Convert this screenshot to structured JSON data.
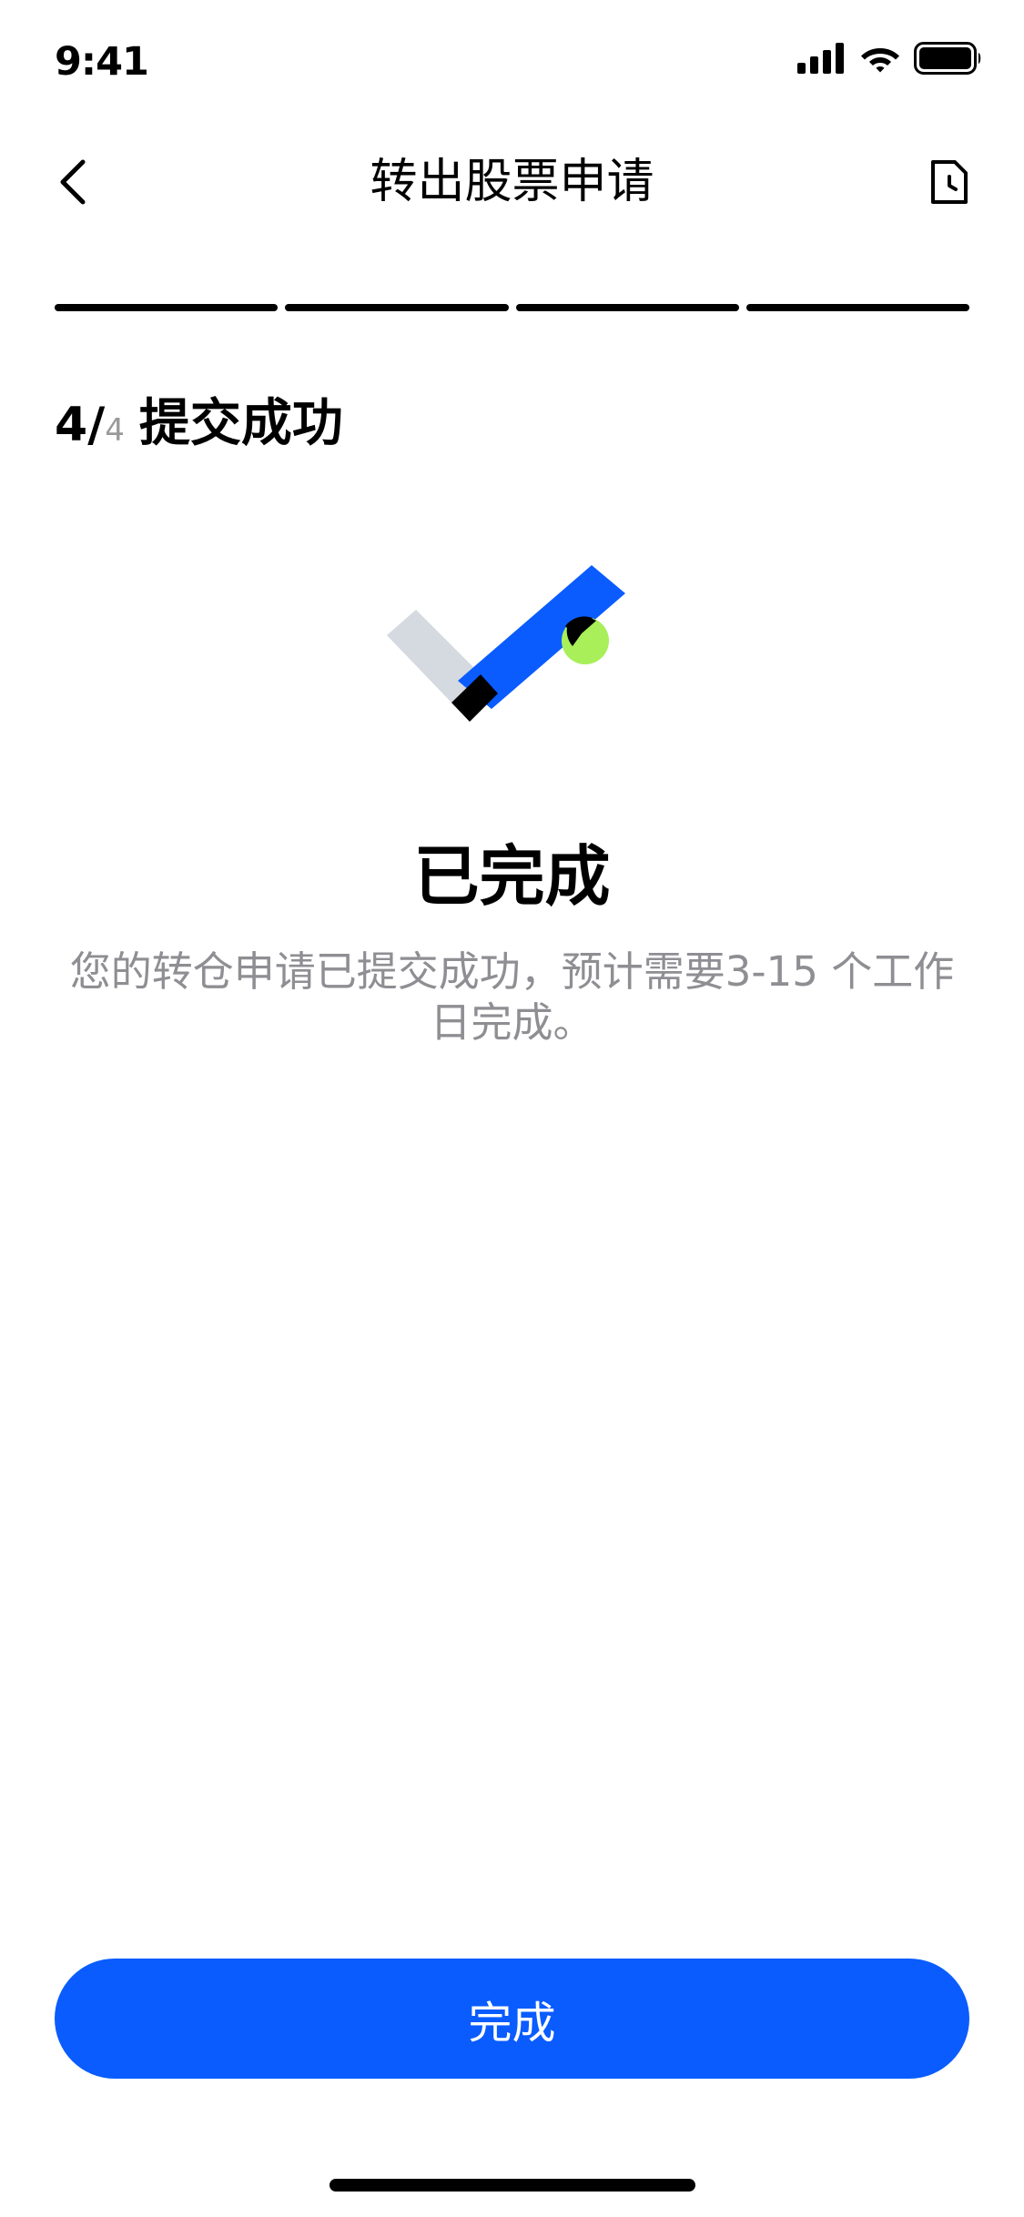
{
  "status_bar": {
    "time": "9:41"
  },
  "nav": {
    "title": "转出股票申请"
  },
  "progress": {
    "current_step": 4,
    "total_steps": 4
  },
  "step": {
    "current": "4",
    "separator": "/",
    "total": "4",
    "title": "提交成功"
  },
  "result": {
    "title": "已完成",
    "description": "您的转仓申请已提交成功，预计需要3-15 个工作日完成。"
  },
  "actions": {
    "done_label": "完成"
  },
  "colors": {
    "accent": "#0a5cff",
    "success_dot": "#a8ef5a",
    "muted_text": "#8e8e93",
    "check_gray": "#d5d9e0"
  },
  "icons": {
    "back": "chevron-left-icon",
    "history": "document-clock-icon",
    "signal": "cellular-signal-icon",
    "wifi": "wifi-icon",
    "battery": "battery-icon"
  }
}
